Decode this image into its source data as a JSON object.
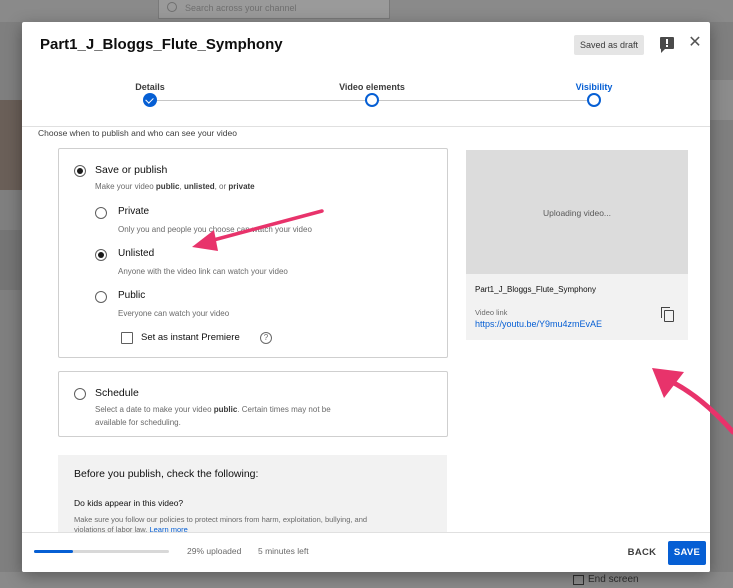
{
  "background": {
    "search_placeholder": "Search across your channel",
    "end_screen_label": "End screen"
  },
  "dialog": {
    "title": "Part1_J_Bloggs_Flute_Symphony",
    "saved_badge": "Saved as draft",
    "feedback_icon": "feedback-icon",
    "close_icon": "close-icon",
    "close_glyph": "✕"
  },
  "stepper": {
    "steps": [
      {
        "label": "Details",
        "state": "done"
      },
      {
        "label": "Video elements",
        "state": "pending"
      },
      {
        "label": "Visibility",
        "state": "current"
      }
    ]
  },
  "visibility": {
    "intro": "Choose when to publish and who can see your video",
    "save_or_publish": {
      "title": "Save or publish",
      "desc_prefix": "Make your video ",
      "desc_public": "public",
      "desc_sep1": ", ",
      "desc_unlisted": "unlisted",
      "desc_sep2": ", or ",
      "desc_private": "private",
      "selected": true,
      "options": [
        {
          "label": "Private",
          "desc": "Only you and people you choose can watch your video",
          "selected": false
        },
        {
          "label": "Unlisted",
          "desc": "Anyone with the video link can watch your video",
          "selected": true
        },
        {
          "label": "Public",
          "desc": "Everyone can watch your video",
          "selected": false
        }
      ],
      "instant_premiere": {
        "label": "Set as instant Premiere",
        "checked": false,
        "help_glyph": "?"
      }
    },
    "schedule": {
      "title": "Schedule",
      "desc_prefix": "Select a date to make your video ",
      "desc_bold": "public",
      "desc_suffix": ". Certain times may not be",
      "desc_line2": "available for scheduling.",
      "selected": false
    },
    "checklist": {
      "title": "Before you publish, check the following:",
      "kids_question": "Do kids appear in this video?",
      "kids_desc": "Make sure you follow our policies to protect minors from harm, exploitation, bullying, and violations of labor law. ",
      "learn_more": "Learn more"
    }
  },
  "preview": {
    "status": "Uploading video...",
    "filename": "Part1_J_Bloggs_Flute_Symphony",
    "video_link_label": "Video link",
    "video_link": "https://youtu.be/Y9mu4zmEvAE",
    "copy_icon": "copy-icon"
  },
  "footer": {
    "progress_percent": 29,
    "upload_status": "29% uploaded",
    "time_left": "5 minutes left",
    "back_label": "BACK",
    "save_label": "SAVE"
  },
  "colors": {
    "accent": "#065fd4",
    "annotation_arrow": "#e8336b",
    "overlay": "#7f7f7f"
  }
}
